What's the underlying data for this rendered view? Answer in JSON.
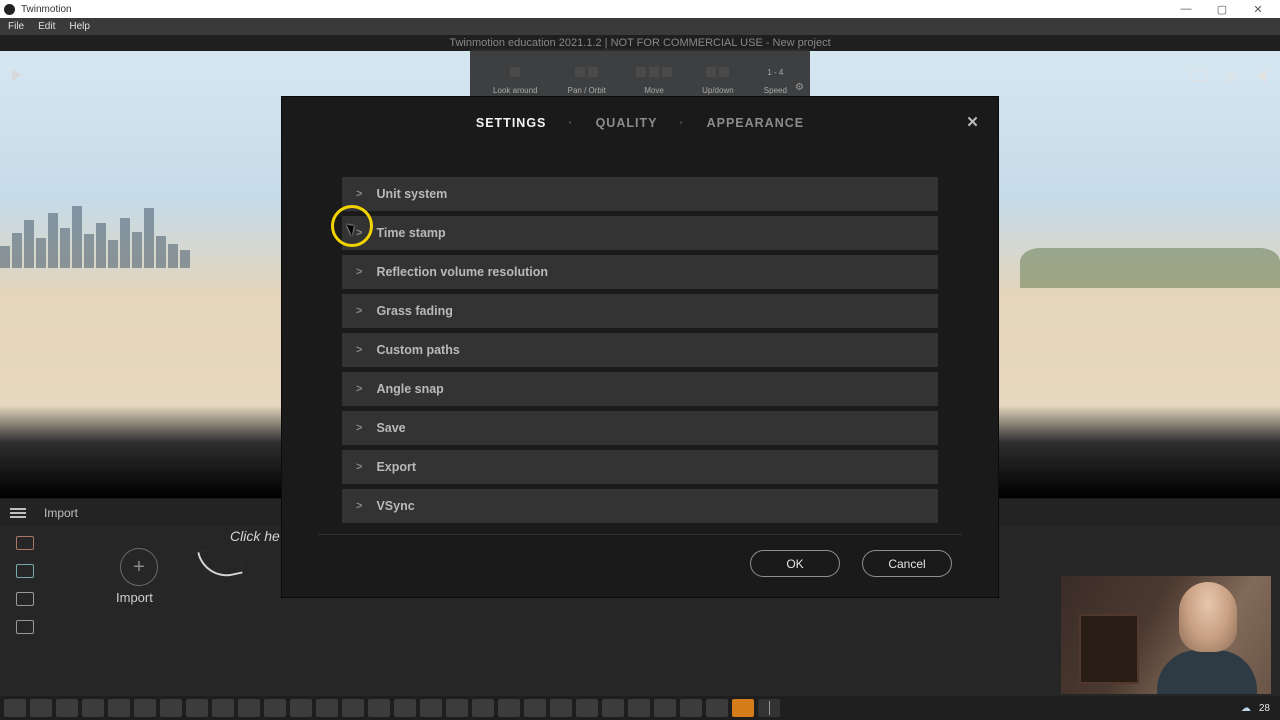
{
  "window": {
    "app_title": "Twinmotion",
    "minimize": "—",
    "maximize": "▢",
    "close": "✕"
  },
  "menubar": {
    "file": "File",
    "edit": "Edit",
    "help": "Help"
  },
  "viewport": {
    "title": "Twinmotion education 2021.1.2 | NOT FOR COMMERCIAL USE - New project",
    "expand": "⤢"
  },
  "navhelp": {
    "lookaround": "Look around",
    "pan": "Pan",
    "orbit": "Orbit",
    "move": "Move",
    "updown": "Up/down",
    "speed": "Speed",
    "speed_val": "1 - 4"
  },
  "bottom": {
    "tab": "Import",
    "import_label": "Import",
    "click_hint": "Click he"
  },
  "dialog": {
    "tabs": {
      "settings": "SETTINGS",
      "quality": "QUALITY",
      "appearance": "APPEARANCE"
    },
    "rows": [
      "Unit system",
      "Time stamp",
      "Reflection volume resolution",
      "Grass fading",
      "Custom paths",
      "Angle snap",
      "Save",
      "Export",
      "VSync"
    ],
    "ok": "OK",
    "cancel": "Cancel",
    "close": "✕"
  },
  "taskbar": {
    "weather_temp": "28",
    "weather_icon": "☁"
  }
}
